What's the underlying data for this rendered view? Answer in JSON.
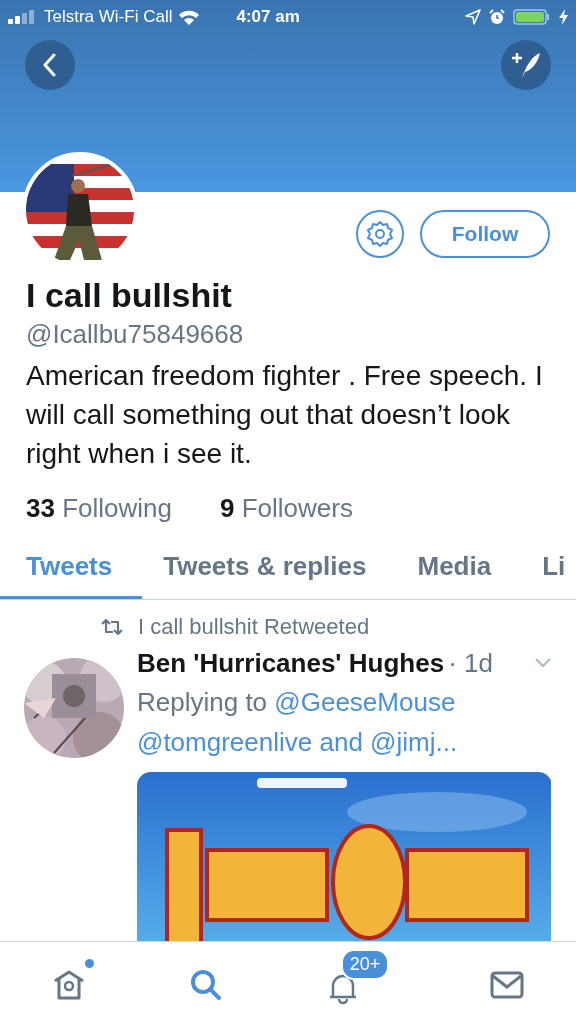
{
  "status_bar": {
    "carrier": "Telstra Wi-Fi Call",
    "time": "4:07 am"
  },
  "profile": {
    "name": "I call bullshit",
    "handle": "@Icallbu75849668",
    "bio": "American freedom fighter . Free speech. I will call something out that doesn’t look right when i see it.",
    "follow_button": "Follow",
    "counts": [
      "**33** Following",
      "**9** Followers"
    ]
  },
  "tabs": [
    {
      "label": "Tweets",
      "selected": true
    },
    {
      "label": "Tweets & replies",
      "selected": false
    },
    {
      "label": "Media",
      "selected": false
    },
    {
      "label": "Li",
      "selected": false
    }
  ],
  "tweet": {
    "retweet_label": "I call bullshit Retweeted",
    "author": "Ben 'Hurricanes' Hughes",
    "separator": "·",
    "time": "1d",
    "reply_prefix": "Replying to",
    "mentions": [
      "@GeeseMouse",
      "@tomgreenlive",
      "@jimj..."
    ],
    "conjunction": "and",
    "media": {
      "kind": "picture"
    }
  },
  "bottom_nav": [
    {
      "kind": "home",
      "selected": false,
      "dot": true
    },
    {
      "kind": "search",
      "selected": true
    },
    {
      "kind": "notifications",
      "selected": false,
      "badge": "20+"
    },
    {
      "kind": "messages",
      "selected": false
    }
  ]
}
